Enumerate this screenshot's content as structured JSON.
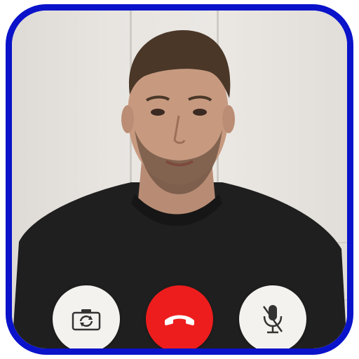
{
  "call": {
    "controls": [
      {
        "name": "switch-camera",
        "icon": "camera-switch-icon"
      },
      {
        "name": "end-call",
        "icon": "hang-up-phone-icon"
      },
      {
        "name": "mute-microphone",
        "icon": "microphone-off-icon"
      }
    ]
  },
  "colors": {
    "frame_border": "#0a13c9",
    "end_call": "#ee1d1d",
    "control_bg": "#f4f2ee",
    "icon": "#333333"
  }
}
